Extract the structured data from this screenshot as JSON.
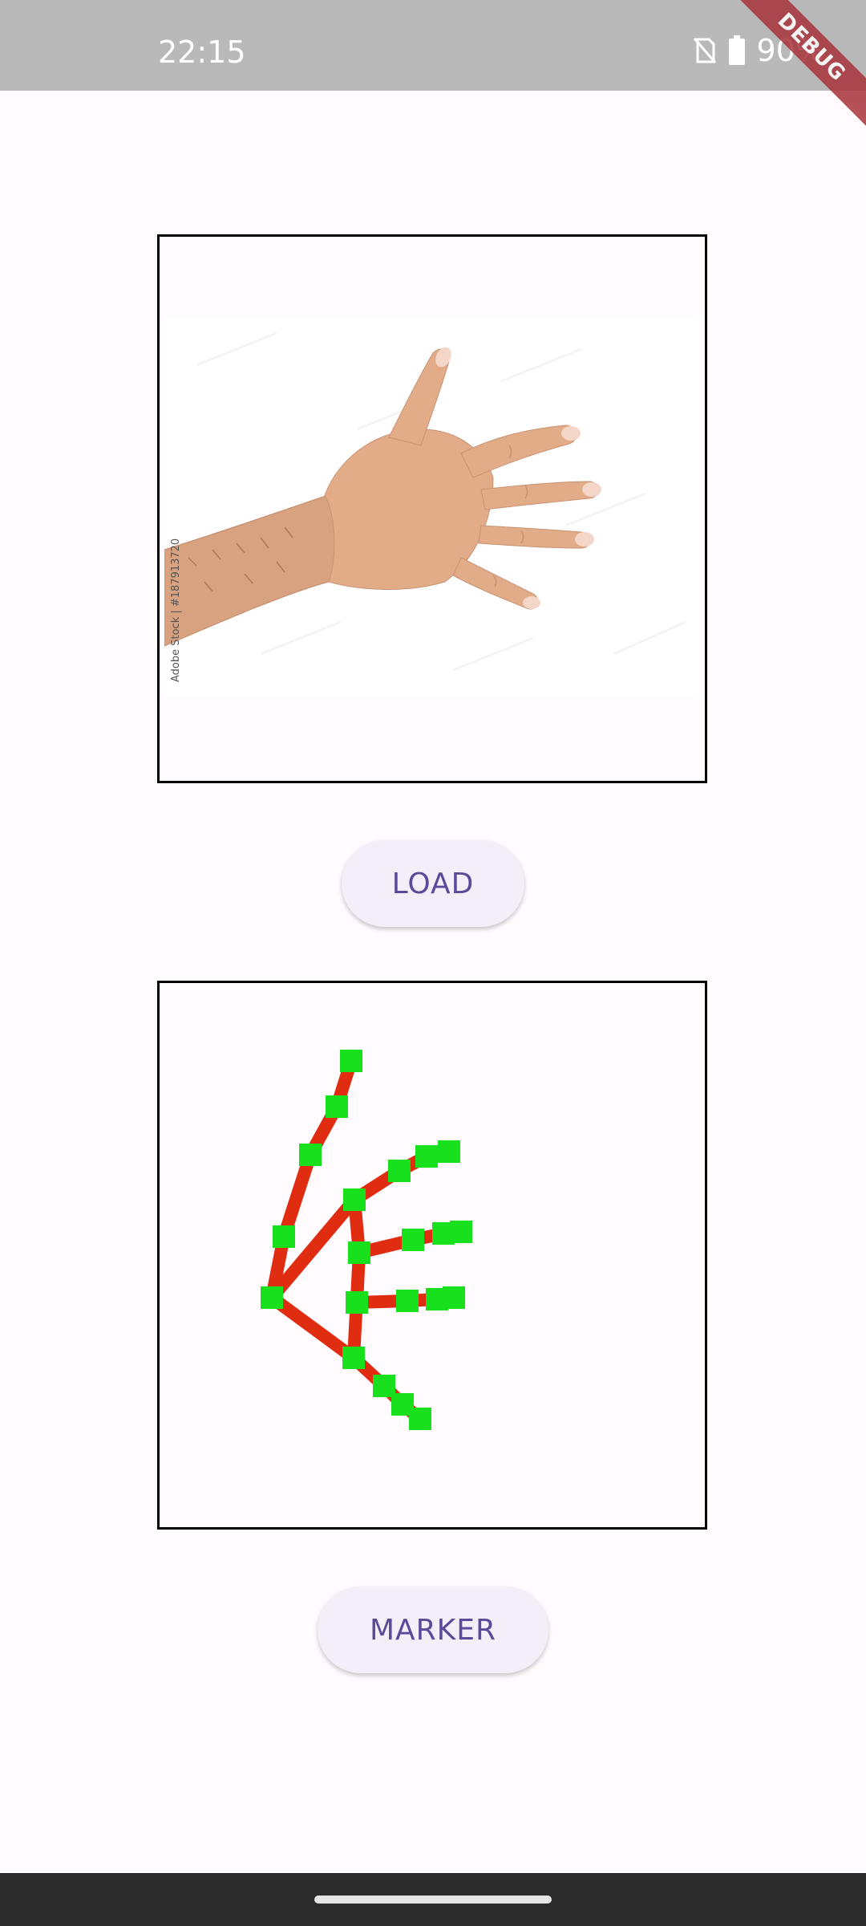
{
  "status_bar": {
    "time": "22:15",
    "battery_percent": "90%",
    "icons": [
      "no-sim-icon",
      "battery-icon"
    ]
  },
  "debug_banner": {
    "label": "DEBUG"
  },
  "image_panel": {
    "watermark": "Adobe Stock | #187913720"
  },
  "load_button": {
    "label": "LOAD"
  },
  "marker_button": {
    "label": "MARKER"
  },
  "marker_panel": {
    "bone_color": "#e02d12",
    "joint_color": "#19e01c"
  },
  "colors": {
    "background": "#fffbfe",
    "status_bar": "#bab9ba",
    "button_bg": "#f3eef7",
    "button_text": "#5b4a9c",
    "nav_bar": "#2b2b2b"
  }
}
